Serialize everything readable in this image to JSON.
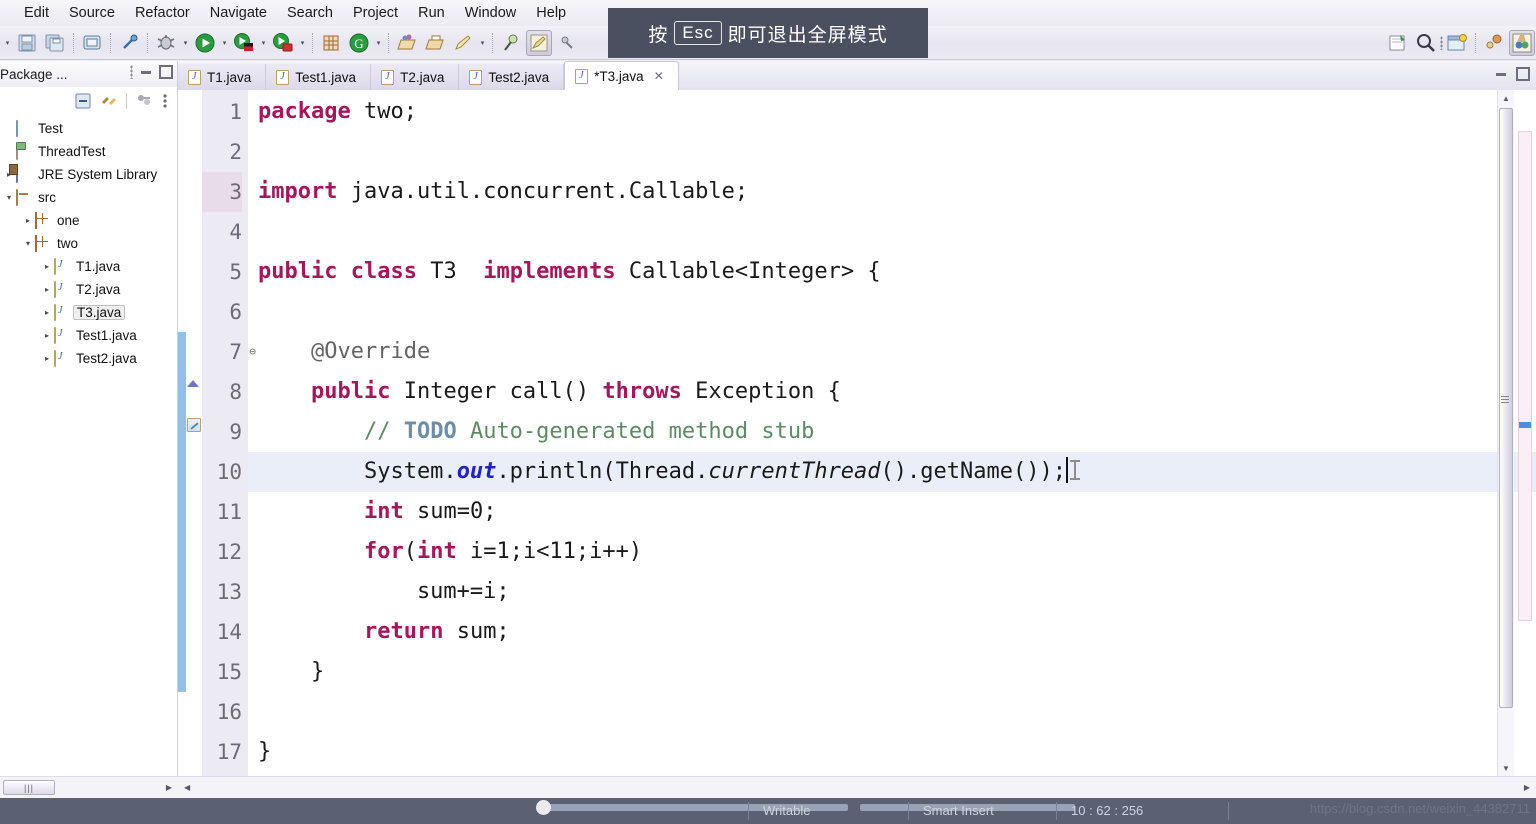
{
  "app": {
    "ide": "Eclipse",
    "fullscreen_overlay": {
      "prefix": "按",
      "key": "Esc",
      "suffix": "即可退出全屏模式"
    }
  },
  "menubar": {
    "items": [
      {
        "label": "Edit"
      },
      {
        "label": "Source"
      },
      {
        "label": "Refactor"
      },
      {
        "label": "Navigate"
      },
      {
        "label": "Search"
      },
      {
        "label": "Project"
      },
      {
        "label": "Run"
      },
      {
        "label": "Window"
      },
      {
        "label": "Help"
      }
    ]
  },
  "toolbar": {
    "icons": [
      "save-icon",
      "save-all-icon",
      "console-icon",
      "link-icon",
      "debug-icon",
      "run-icon",
      "external-tools-icon",
      "run-last-icon",
      "new-java-project-icon",
      "coverage-icon",
      "open-type-icon",
      "open-task-icon",
      "search-ref-icon",
      "pin-icon",
      "edit-icon",
      "spray-icon",
      "new-wizard-icon"
    ],
    "right_icons": [
      "search-icon",
      "open-perspective-icon",
      "java-perspective-icon",
      "debug-perspective-icon"
    ]
  },
  "sidebar": {
    "title": "Package ...",
    "view_buttons": [
      "collapse-all-icon",
      "link-with-editor-icon",
      "view-menu-icon",
      "view-more-icon"
    ],
    "header_buttons": [
      "minimize-icon",
      "maximize-icon"
    ],
    "tree": [
      {
        "label": "Test",
        "indent": 0,
        "twisty": "",
        "icon": "folder-blue-icon",
        "selected": false
      },
      {
        "label": "ThreadTest",
        "indent": 0,
        "twisty": "",
        "icon": "java-project-icon",
        "selected": false
      },
      {
        "label": "JRE System Library",
        "indent": 0,
        "twisty": "▸",
        "icon": "library-icon",
        "selected": false
      },
      {
        "label": "src",
        "indent": 0,
        "twisty": "▾",
        "icon": "source-folder-icon",
        "selected": false
      },
      {
        "label": "one",
        "indent": 1,
        "twisty": "▸",
        "icon": "package-icon",
        "selected": false
      },
      {
        "label": "two",
        "indent": 1,
        "twisty": "▾",
        "icon": "package-icon",
        "selected": false
      },
      {
        "label": "T1.java",
        "indent": 2,
        "twisty": "▸",
        "icon": "java-file-icon",
        "selected": false
      },
      {
        "label": "T2.java",
        "indent": 2,
        "twisty": "▸",
        "icon": "java-file-icon",
        "selected": false
      },
      {
        "label": "T3.java",
        "indent": 2,
        "twisty": "▸",
        "icon": "java-file-icon",
        "selected": true
      },
      {
        "label": "Test1.java",
        "indent": 2,
        "twisty": "▸",
        "icon": "java-file-icon",
        "selected": false
      },
      {
        "label": "Test2.java",
        "indent": 2,
        "twisty": "▸",
        "icon": "java-file-icon",
        "selected": false
      }
    ]
  },
  "editor": {
    "tabs": [
      {
        "label": "T1.java",
        "active": false,
        "dirty": false
      },
      {
        "label": "Test1.java",
        "active": false,
        "dirty": false
      },
      {
        "label": "T2.java",
        "active": false,
        "dirty": false
      },
      {
        "label": "Test2.java",
        "active": false,
        "dirty": false
      },
      {
        "label": "*T3.java",
        "active": true,
        "dirty": true
      }
    ],
    "close_glyph": "✕",
    "current_line": 10,
    "line_numbers": [
      "1",
      "2",
      "3",
      "4",
      "5",
      "6",
      "7",
      "8",
      "9",
      "10",
      "11",
      "12",
      "13",
      "14",
      "15",
      "16",
      "17"
    ],
    "code_lines": [
      "package two;",
      "",
      "import java.util.concurrent.Callable;",
      "",
      "public class T3  implements Callable<Integer> {",
      "",
      "    @Override",
      "    public Integer call() throws Exception {",
      "        // TODO Auto-generated method stub",
      "        System.out.println(Thread.currentThread().getName());",
      "        int sum=0;",
      "        for(int i=1;i<11;i++)",
      "            sum+=i;",
      "        return sum;",
      "    }",
      "",
      "}"
    ]
  },
  "statusbar": {
    "writable": "Writable",
    "insert_mode": "Smart Insert",
    "position": "10 : 62 : 256",
    "watermark": "https://blog.csdn.net/weixin_44382711"
  },
  "colors": {
    "keyword": "#a5175b",
    "comment": "#5c8a63",
    "todo_tag": "#6a8fa8",
    "static_field": "#2222cc",
    "current_line_bg": "#e9eef9",
    "change_bar": "#8dc0ec",
    "statusbar_bg": "#5b6173",
    "overlay_bg": "#4b5060"
  }
}
